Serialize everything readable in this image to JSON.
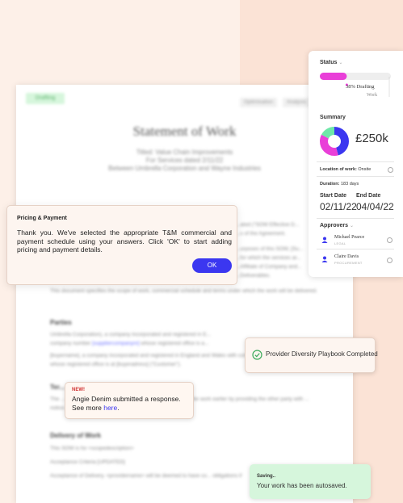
{
  "document": {
    "status_tag": "Drafting",
    "tabs": [
      "Optimisation",
      "Analysis"
    ],
    "title": "Statement of Work",
    "subtitle_lines": [
      "Titled: Value Chain Improvements",
      "For Services dated 2/11/22",
      "Between Umbrella Corporation and Wayne Industries"
    ],
    "snippets": {
      "fragment1": "...ated (\"SOW Effective D...",
      "fragment2": "...s of the Agreement.",
      "fragment3": "...urposes of this SOW, [Su...",
      "fragment4": "...for which the services ar...",
      "fragment5": "...Affiliate of Company and...",
      "fragment6": "...Deliverables.",
      "scope_para": "This document specifies the scope of work, commercial schedule and terms under which the work will be delivered.",
      "parties_heading": "Parties",
      "parties_para1_a": "Umbrella Corporation), a company incorporated and registered in E...",
      "parties_para1_b": "company number ",
      "parties_para1_link": "[suppliercompanynr]",
      "parties_para1_c": " whose registered office is a...",
      "parties_para2": "[buyername], a company incorporated and registered in England and Wales with company number [buyerlegalentity] whose registered office is at [buyeradress] (\"Customer\").",
      "term_heading": "Ter...",
      "term_para": "The ... will end on the earlier of the completion of the Servi... the work earlier by providing the other party with ... notice.",
      "delivery_heading": "Delivery of Work",
      "delivery_para1": "This SOW is for <scopedescription>",
      "delivery_para2": "Acceptance Criteria [UPDATED]",
      "delivery_para3": "Acceptance of Delivery. <providername> will be deemed to have co... obligations if"
    }
  },
  "pricing_dialog": {
    "title": "Pricing & Payment",
    "text": "Thank you. We've selected the appropriate T&M commercial and payment schedule using your answers. Click 'OK' to start adding pricing and payment details.",
    "ok_label": "OK"
  },
  "status_panel": {
    "status_label": "Status",
    "progress_fraction": 0.38,
    "progress_text": "38% Drafting",
    "work_label": "Work",
    "summary_label": "Summary",
    "amount": "£250k",
    "location_label": "Location of work:",
    "location_value": "Onsite",
    "duration_label": "Duration:",
    "duration_value": "183 days",
    "start_label": "Start Date",
    "start_value": "02/11/22",
    "end_label": "End Date",
    "end_value": "04/04/22",
    "approvers_label": "Approvers",
    "approvers": [
      {
        "name": "Michael Pearce",
        "role": "LEGAL"
      },
      {
        "name": "Claire Davis",
        "role": "PROCUREMENT"
      }
    ]
  },
  "diversity_toast": {
    "text": "Provider Diversity Playbook Completed"
  },
  "response_toast": {
    "badge": "NEW!",
    "line1": "Angie Denim submitted a response.",
    "line2_prefix": "See more ",
    "line2_link": "here",
    "line2_suffix": "."
  },
  "autosave_toast": {
    "title": "Saving..",
    "text": "Your work has been autosaved."
  },
  "colors": {
    "accent_blue": "#3b37f0",
    "progress_pink": "#e93fd8",
    "green": "#59b06a",
    "donut": [
      "#3b37f0",
      "#e93fd8",
      "#6ee7a8"
    ]
  }
}
